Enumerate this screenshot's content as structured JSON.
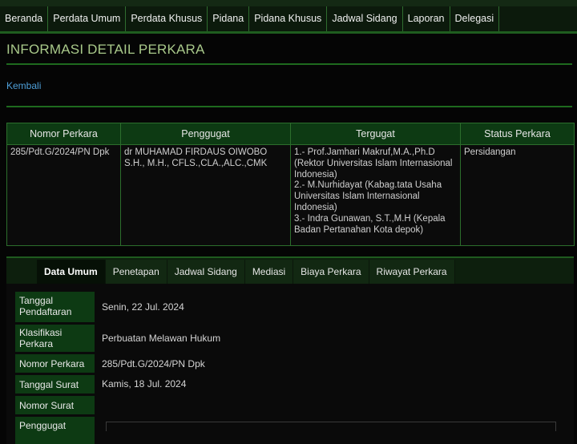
{
  "nav": {
    "items": [
      "Beranda",
      "Perdata Umum",
      "Perdata Khusus",
      "Pidana",
      "Pidana Khusus",
      "Jadwal Sidang",
      "Laporan",
      "Delegasi"
    ]
  },
  "page": {
    "title": "INFORMASI DETAIL PERKARA",
    "back_label": "Kembali"
  },
  "case_table": {
    "headers": [
      "Nomor Perkara",
      "Penggugat",
      "Tergugat",
      "Status Perkara"
    ],
    "row": {
      "nomor": "285/Pdt.G/2024/PN Dpk",
      "penggugat": "dr MUHAMAD FIRDAUS OIWOBO S.H., M.H., CFLS.,CLA.,ALC.,CMK",
      "tergugat": [
        "1.- Prof.Jamhari Makruf,M.A.,Ph.D (Rektor Universitas Islam Internasional Indonesia)",
        "2.- M.Nurhidayat (Kabag.tata Usaha Universitas Islam Internasional Indonesia)",
        "3.- Indra Gunawan, S.T.,M.H (Kepala Badan Pertanahan Kota depok)"
      ],
      "status": "Persidangan"
    }
  },
  "tabs": {
    "items": [
      "Data Umum",
      "Penetapan",
      "Jadwal Sidang",
      "Mediasi",
      "Biaya Perkara",
      "Riwayat Perkara"
    ],
    "active": "Data Umum"
  },
  "data_umum": {
    "tanggal_pendaftaran": {
      "label": "Tanggal Pendaftaran",
      "value": "Senin, 22 Jul. 2024"
    },
    "klasifikasi_perkara": {
      "label": "Klasifikasi Perkara",
      "value": "Perbuatan Melawan Hukum"
    },
    "nomor_perkara": {
      "label": "Nomor Perkara",
      "value": "285/Pdt.G/2024/PN Dpk"
    },
    "tanggal_surat": {
      "label": "Tanggal Surat",
      "value": "Kamis, 18 Jul. 2024"
    },
    "nomor_surat": {
      "label": "Nomor Surat",
      "value": ""
    },
    "penggugat": {
      "label": "Penggugat",
      "value": ""
    }
  }
}
